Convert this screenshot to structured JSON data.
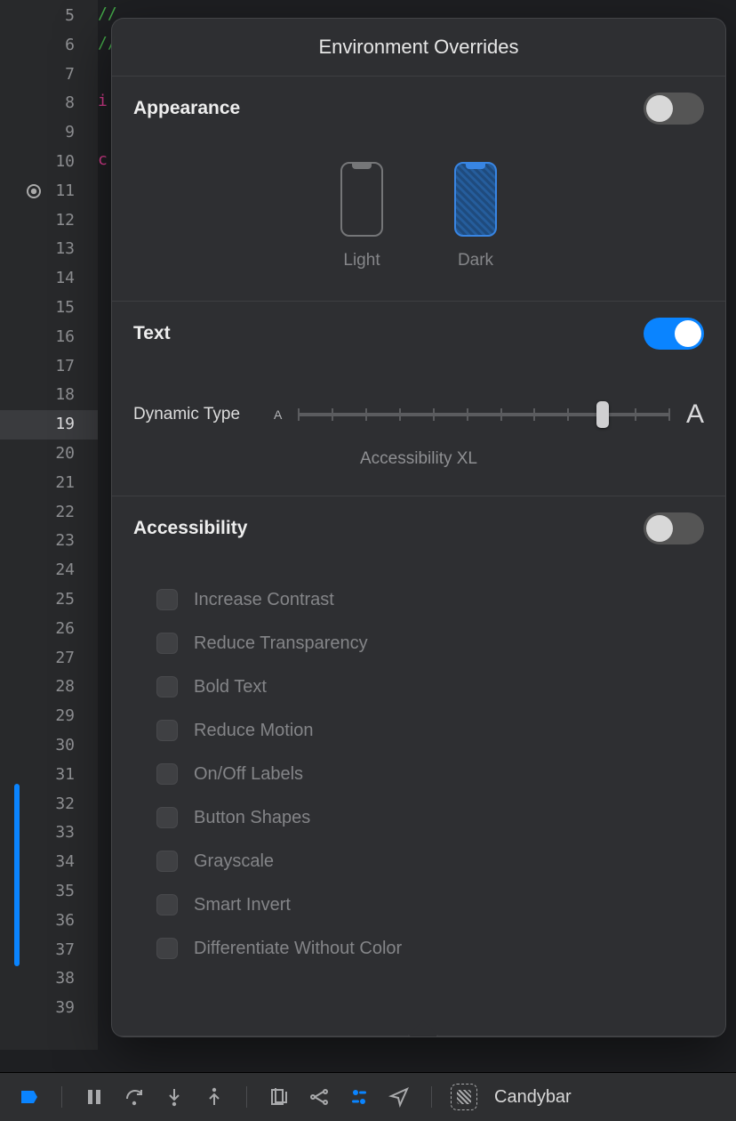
{
  "gutter": {
    "lines": [
      5,
      6,
      7,
      8,
      9,
      10,
      11,
      12,
      13,
      14,
      15,
      16,
      17,
      18,
      19,
      20,
      21,
      22,
      23,
      24,
      25,
      26,
      27,
      28,
      29,
      30,
      31,
      32,
      33,
      34,
      35,
      36,
      37,
      38,
      39
    ],
    "current_line": 19,
    "breakpoint_line": 11,
    "change_bar_start": 31,
    "change_bar_end": 36
  },
  "code_fragments": {
    "line5": "//",
    "line6": "//",
    "line8": "i",
    "line10": "c",
    "line39": "}"
  },
  "popover": {
    "title": "Environment Overrides",
    "sections": {
      "appearance": {
        "title": "Appearance",
        "enabled": false,
        "options": {
          "light": "Light",
          "dark": "Dark"
        },
        "selected": "dark"
      },
      "text": {
        "title": "Text",
        "enabled": true,
        "dynamic_type_label": "Dynamic Type",
        "slider": {
          "ticks": 12,
          "value_index": 9
        },
        "current_value_label": "Accessibility XL"
      },
      "accessibility": {
        "title": "Accessibility",
        "enabled": false,
        "options": [
          "Increase Contrast",
          "Reduce Transparency",
          "Bold Text",
          "Reduce Motion",
          "On/Off Labels",
          "Button Shapes",
          "Grayscale",
          "Smart Invert",
          "Differentiate Without Color"
        ]
      }
    }
  },
  "debug_bar": {
    "target_label": "Candybar"
  }
}
